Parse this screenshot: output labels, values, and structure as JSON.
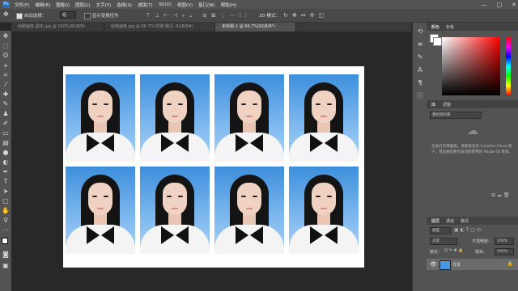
{
  "app": {
    "logo": "Ps"
  },
  "menu": [
    "文件(F)",
    "编辑(E)",
    "图像(I)",
    "图层(L)",
    "文字(Y)",
    "选择(S)",
    "滤镜(T)",
    "3D(D)",
    "视图(V)",
    "窗口(W)",
    "帮助(H)"
  ],
  "window_controls": {
    "minimize": "—",
    "maximize": "□",
    "close": "✕"
  },
  "options_bar": {
    "auto_select_label": "自动选择：",
    "auto_select_value": "组",
    "transform_label": "显示变换控件",
    "mode_3d_label": "3D 模式："
  },
  "tabs": [
    {
      "label": "绘制画像 副本.jpg @ 100%(RGB/8)",
      "active": false
    },
    {
      "label": "绘制画像.jpg @ 66.7%(背景 拷贝, RGB/8#)",
      "active": false
    },
    {
      "label": "未标题-1 @ 66.7%(RGB/8*)",
      "active": true
    }
  ],
  "tools": [
    "move-tool-icon",
    "marquee-tool-icon",
    "lasso-tool-icon",
    "magic-wand-tool-icon",
    "crop-tool-icon",
    "eyedropper-tool-icon",
    "healing-brush-tool-icon",
    "brush-tool-icon",
    "clone-stamp-tool-icon",
    "history-brush-tool-icon",
    "eraser-tool-icon",
    "gradient-tool-icon",
    "blur-tool-icon",
    "dodge-tool-icon",
    "pen-tool-icon",
    "type-tool-icon",
    "path-selection-tool-icon",
    "shape-tool-icon",
    "hand-tool-icon",
    "zoom-tool-icon",
    "edit-toolbar-icon",
    "color-swatches-icon",
    "quick-mask-icon",
    "screen-mode-icon"
  ],
  "panels": {
    "color": {
      "tab1": "颜色",
      "tab2": "色板"
    },
    "libraries": {
      "tab1": "库",
      "tab2": "调整"
    },
    "library_dropdown": "我的资料库",
    "library_message": "在此打开库面板，请登录您的 Creative Cloud 账户，或选择您要为该功能使用的 Adobe ID 登录。",
    "layers": {
      "tab1": "图层",
      "tab2": "通道",
      "tab3": "路径"
    },
    "layer_kind": "类型",
    "blend_mode": "正常",
    "opacity_label": "不透明度：",
    "opacity_value": "100%",
    "lock_label": "锁定：",
    "fill_label": "填充：",
    "fill_value": "100%",
    "layer_name": "背景"
  },
  "document": {
    "photo_count": 8,
    "photo_background": "#4a97e0"
  }
}
